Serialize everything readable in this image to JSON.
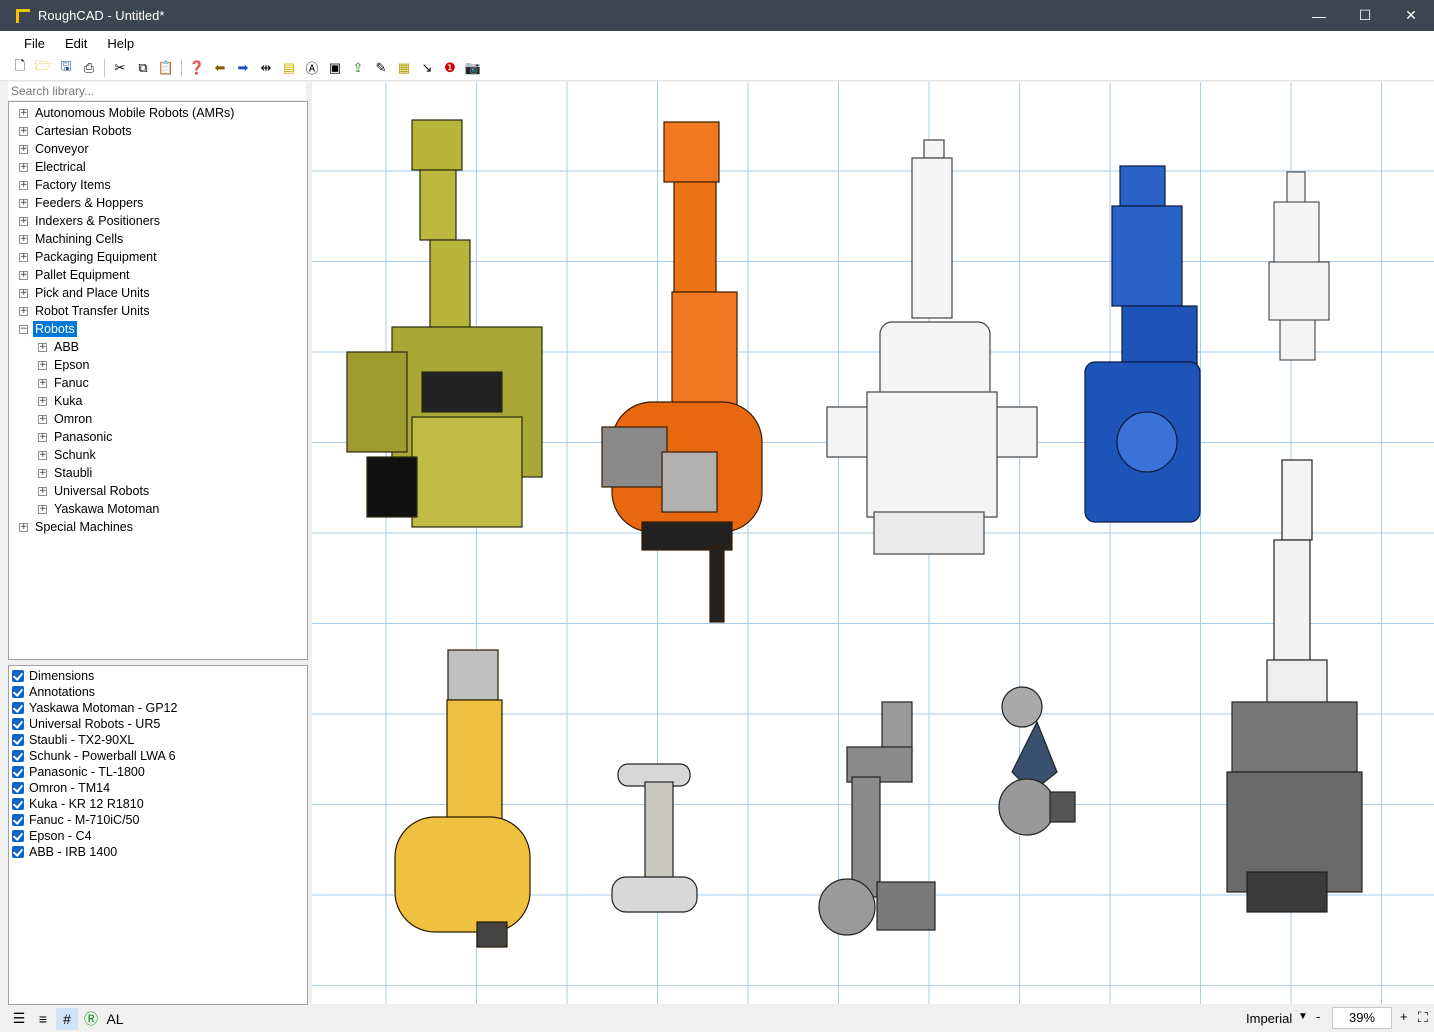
{
  "window": {
    "title": "RoughCAD - Untitled*"
  },
  "menu": [
    "File",
    "Edit",
    "Help"
  ],
  "search": {
    "placeholder": "Search library..."
  },
  "tree": {
    "top_before": [
      "Autonomous Mobile Robots (AMRs)",
      "Cartesian Robots",
      "Conveyor",
      "Electrical",
      "Factory Items",
      "Feeders & Hoppers",
      "Indexers & Positioners",
      "Machining Cells",
      "Packaging Equipment",
      "Pallet Equipment",
      "Pick and Place Units",
      "Robot Transfer Units"
    ],
    "expanded": "Robots",
    "children": [
      "ABB",
      "Epson",
      "Fanuc",
      "Kuka",
      "Omron",
      "Panasonic",
      "Schunk",
      "Staubli",
      "Universal Robots",
      "Yaskawa Motoman"
    ],
    "top_after": [
      "Special Machines"
    ]
  },
  "layers": [
    "Dimensions",
    "Annotations",
    "Yaskawa Motoman - GP12",
    "Universal Robots - UR5",
    "Staubli - TX2-90XL",
    "Schunk - Powerball LWA 6",
    "Panasonic - TL-1800",
    "Omron - TM14",
    "Kuka - KR 12 R1810",
    "Fanuc - M-710iC/50",
    "Epson - C4",
    "ABB - IRB 1400"
  ],
  "status": {
    "units": "Imperial",
    "zoom": "39%",
    "zoom_minus": "-",
    "zoom_plus": "+",
    "al_label": "AL"
  },
  "colors": {
    "fanuc": "#b7b43a",
    "kuka": "#f07820",
    "staubli": "#f4f4f4",
    "yaskawa": "#2a62c8",
    "abb_yellow": "#f0c040",
    "grid": "#a9cdea"
  }
}
